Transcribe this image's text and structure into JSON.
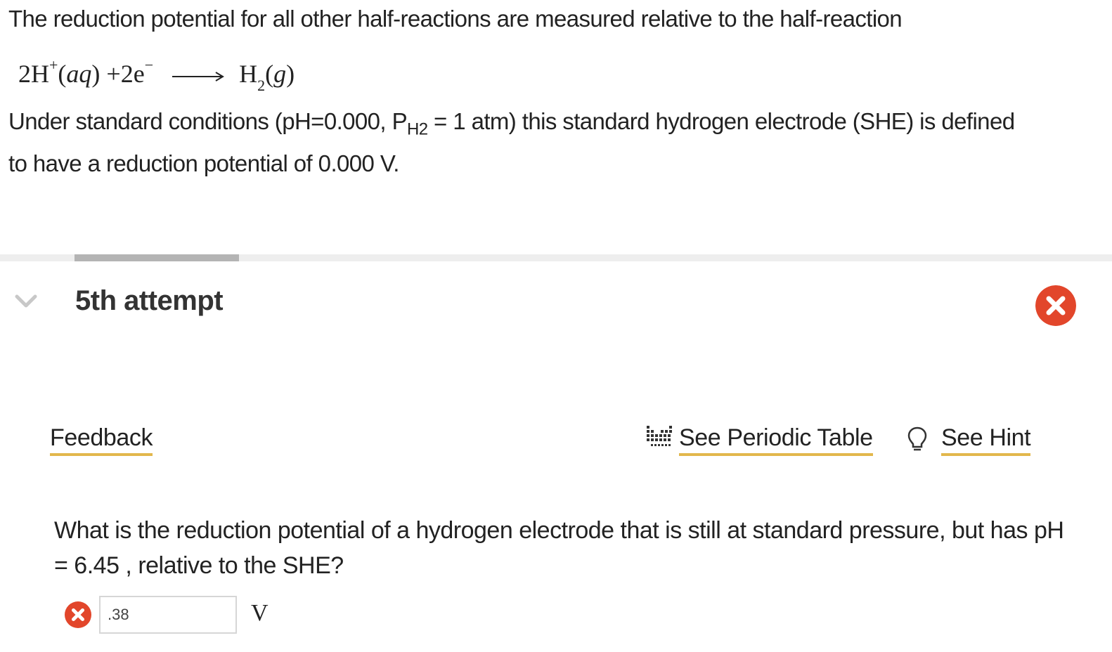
{
  "intro": {
    "line1": "The reduction potential for all other half-reactions are measured relative to the half-reaction",
    "equation": {
      "reactant_coef": "2H",
      "reactant_charge": "+",
      "reactant_state": "aq",
      "plus": "+",
      "electron": "2e",
      "electron_charge": "−",
      "product": "H",
      "product_sub": "2",
      "product_state": "g"
    },
    "line2_pre": "Under standard conditions (pH=0.000, P",
    "line2_sub": "H2",
    "line2_post": " = 1 atm) this standard hydrogen electrode (SHE) is defined",
    "line3": "to have a reduction potential of 0.000 V."
  },
  "attempt": {
    "title": "5th attempt",
    "status": "incorrect",
    "progress_fraction": 0.148
  },
  "links": {
    "feedback": "Feedback",
    "periodic_table": "See Periodic Table",
    "hint": "See Hint"
  },
  "question": {
    "text": "What is the reduction potential of a hydrogen electrode that is still at standard pressure, but has pH = 6.45 , relative to the SHE?"
  },
  "answer": {
    "value": ".38",
    "unit": "V",
    "status": "incorrect"
  },
  "colors": {
    "error_red": "#e2462b",
    "link_underline": "#e2b74c",
    "divider": "#eeeeee",
    "divider_progress": "#b4b4b4"
  },
  "icons": {
    "chevron": "chevron-down-icon",
    "close": "close-circle-icon",
    "periodic_table": "periodic-table-icon",
    "hint": "lightbulb-icon",
    "answer_status": "incorrect-x-icon"
  }
}
